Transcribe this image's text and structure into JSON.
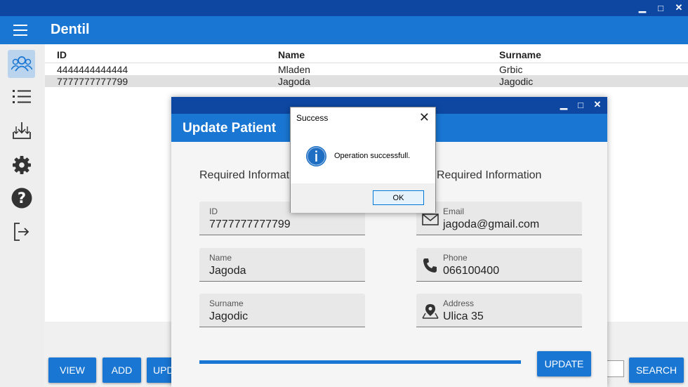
{
  "window": {
    "minimize": "▁",
    "maximize": "□",
    "close": "✕"
  },
  "app": {
    "title": "Dentil",
    "menu_icon": "hamburger-icon"
  },
  "sidebar": {
    "items": [
      {
        "icon": "patients-icon",
        "active": true
      },
      {
        "icon": "list-icon",
        "active": false
      },
      {
        "icon": "import-icon",
        "active": false
      },
      {
        "icon": "gear-icon",
        "active": false
      },
      {
        "icon": "help-icon",
        "active": false
      },
      {
        "icon": "logout-icon",
        "active": false
      }
    ]
  },
  "table": {
    "headers": [
      "ID",
      "Name",
      "Surname"
    ],
    "rows": [
      [
        "4444444444444",
        "Mladen",
        "Grbic"
      ],
      [
        "7777777777799",
        "Jagoda",
        "Jagodic"
      ]
    ]
  },
  "bottom_bar": {
    "view": "VIEW",
    "add": "ADD",
    "update_partial": "UPD",
    "search": "SEARCH"
  },
  "update_window": {
    "title": "Update Patient",
    "left_section": "Required Informatio",
    "right_section": "Required Information",
    "fields": {
      "id": {
        "label": "ID",
        "value": "7777777777799"
      },
      "name": {
        "label": "Name",
        "value": "Jagoda"
      },
      "surname": {
        "label": "Surname",
        "value": "Jagodic"
      },
      "email": {
        "label": "Email",
        "value": "jagoda@gmail.com",
        "icon": "email-icon"
      },
      "phone": {
        "label": "Phone",
        "value": "066100400",
        "icon": "phone-icon"
      },
      "address": {
        "label": "Address",
        "value": "Ulica 35",
        "icon": "location-icon"
      }
    },
    "progress": 1.0,
    "update_button": "UPDATE"
  },
  "message_box": {
    "title": "Success",
    "text": "Operation successfull.",
    "icon": "info-icon",
    "ok": "OK",
    "close": "✕"
  },
  "colors": {
    "primary": "#1976d2",
    "dark": "#0d47a1"
  }
}
